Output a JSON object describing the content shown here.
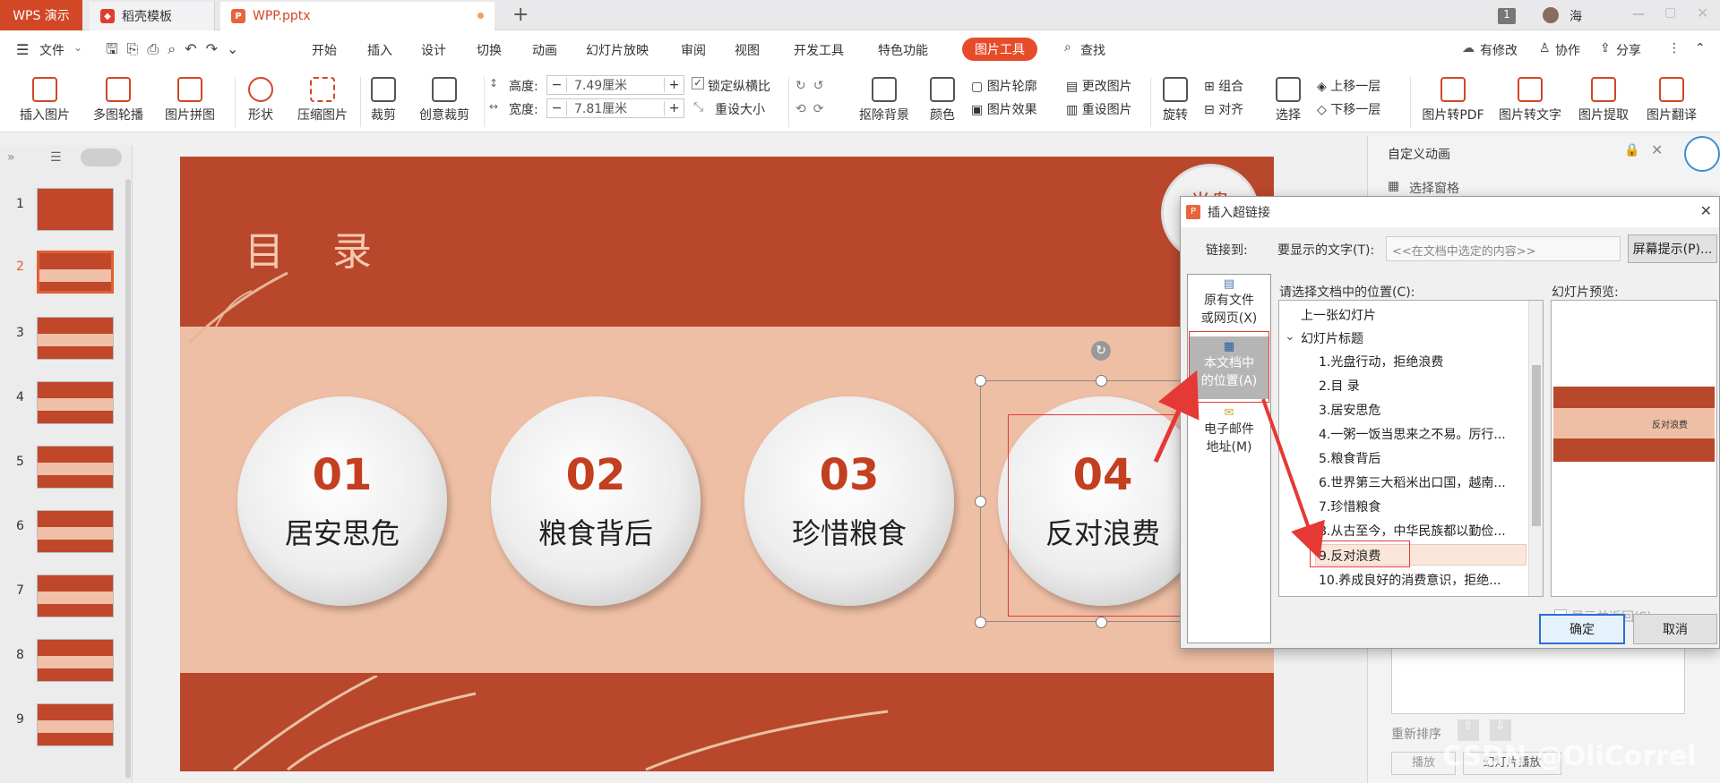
{
  "titlebar": {
    "app_tab": "WPS 演示",
    "tabs": [
      {
        "label": "稻壳模板"
      },
      {
        "label": "WPP.pptx"
      }
    ],
    "badge": "1",
    "user": "海"
  },
  "menubar": {
    "file": "文件",
    "items": [
      "开始",
      "插入",
      "设计",
      "切换",
      "动画",
      "幻灯片放映",
      "审阅",
      "视图",
      "开发工具",
      "特色功能"
    ],
    "active": "图片工具",
    "search": "查找",
    "right": [
      "有修改",
      "协作",
      "分享"
    ]
  },
  "ribbon": {
    "insert_picture": "插入图片",
    "multi_carousel": "多图轮播",
    "picture_collage": "图片拼图",
    "shape": "形状",
    "compress": "压缩图片",
    "crop": "裁剪",
    "creative_crop": "创意裁剪",
    "height_label": "高度:",
    "height_value": "7.49厘米",
    "width_label": "宽度:",
    "width_value": "7.81厘米",
    "lock_ratio": "锁定纵横比",
    "resize": "重设大小",
    "remove_bg": "抠除背景",
    "color": "颜色",
    "outline": "图片轮廓",
    "change_pic": "更改图片",
    "effects": "图片效果",
    "reset_pic": "重设图片",
    "rotate": "旋转",
    "group": "组合",
    "align": "对齐",
    "select": "选择",
    "bring_forward": "上移一层",
    "send_backward": "下移一层",
    "to_pdf": "图片转PDF",
    "to_text": "图片转文字",
    "extract": "图片提取",
    "translate": "图片翻译"
  },
  "thumbnails": [
    "1",
    "2",
    "3",
    "4",
    "5",
    "6",
    "7",
    "8",
    "9"
  ],
  "slide": {
    "title": "目 录",
    "plates": [
      {
        "num": "01",
        "label": "居安思危"
      },
      {
        "num": "02",
        "label": "粮食背后"
      },
      {
        "num": "03",
        "label": "珍惜粮食"
      },
      {
        "num": "04",
        "label": "反对浪费"
      }
    ],
    "corner_text": "光盘"
  },
  "anim_panel": {
    "title": "自定义动画",
    "select_pane": "选择窗格",
    "reorder": "重新排序",
    "play": "播放",
    "slideshow": "幻灯片播放"
  },
  "dialog": {
    "title": "插入超链接",
    "link_to": "链接到:",
    "display_text_label": "要显示的文字(T):",
    "display_text_placeholder": "<<在文档中选定的内容>>",
    "screen_tip": "屏幕提示(P)...",
    "place_label": "请选择文档中的位置(C):",
    "preview_label": "幻灯片预览:",
    "nav": [
      {
        "line1": "原有文件",
        "line2": "或网页(X)"
      },
      {
        "line1": "本文档中",
        "line2": "的位置(A)"
      },
      {
        "line1": "电子邮件",
        "line2": "地址(M)"
      }
    ],
    "tree": [
      "上一张幻灯片",
      "幻灯片标题",
      "1.光盘行动，拒绝浪费",
      "2.目 录",
      "3.居安思危",
      "4.一粥一饭当思来之不易。厉行...",
      "5.粮食背后",
      "6.世界第三大稻米出口国，越南...",
      "7.珍惜粮食",
      "8.从古至今，中华民族都以勤俭...",
      "9.反对浪费",
      "10.养成良好的消费意识，拒绝..."
    ],
    "preview_text": "反对浪费",
    "show_return": "显示并返回(S)",
    "ok": "确定",
    "cancel": "取消"
  },
  "watermark": "CSDN @OliCorrel"
}
